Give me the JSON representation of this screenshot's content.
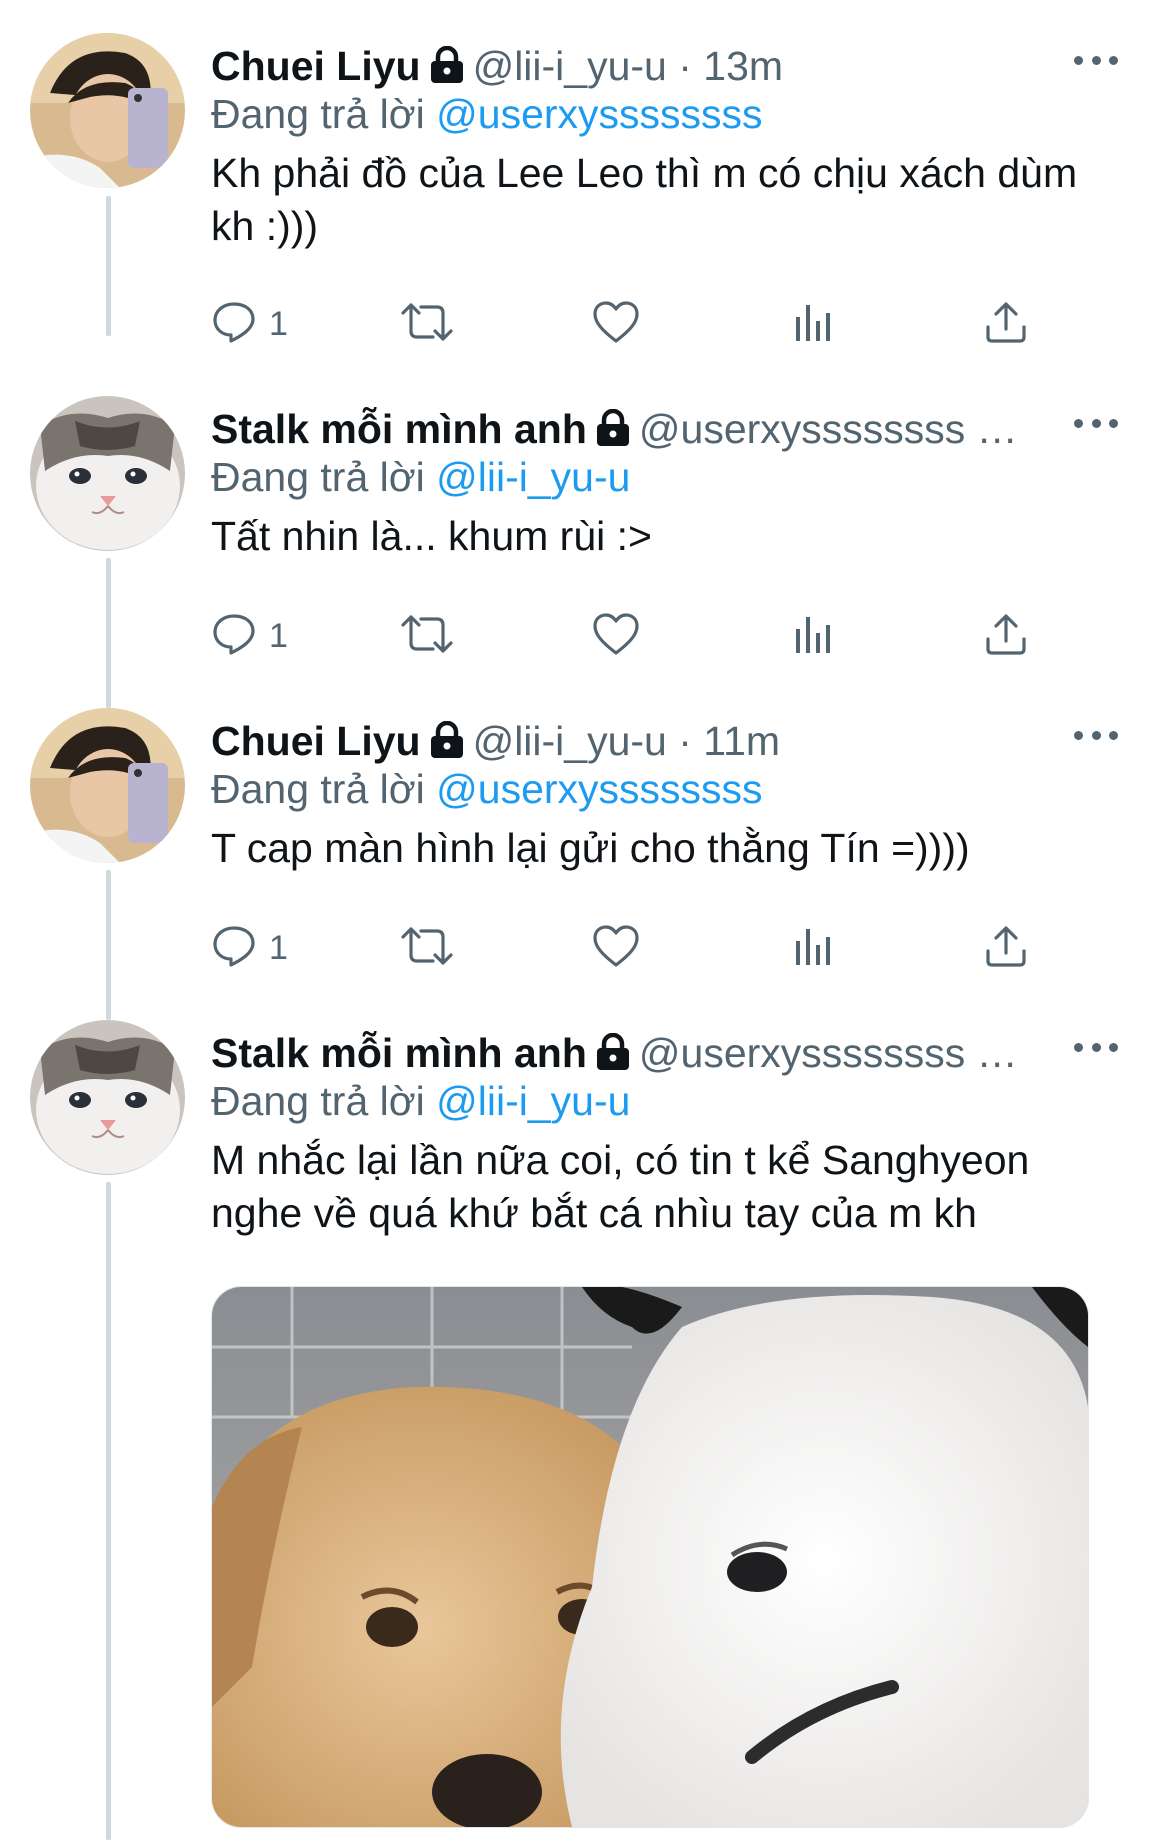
{
  "colors": {
    "accent": "#1d9bf0",
    "secondary_text": "#536471",
    "thread_line": "#cfd9de"
  },
  "tweets": [
    {
      "name": "Chuei Liyu",
      "handle": "@lii-i_yu-u",
      "time": "· 13m",
      "replying_to_label": "Đang trả lời",
      "replying_to": "@userxyssssssss",
      "text": "Kh phải đồ của Lee Leo thì m có chịu xách dùm kh :)))",
      "reply_count": "1",
      "avatar_icon": "avatar-boy-selfie-icon"
    },
    {
      "name": "Stalk mỗi mình anh",
      "handle": "@userxyssssssss …",
      "time": "",
      "replying_to_label": "Đang trả lời",
      "replying_to": "@lii-i_yu-u",
      "text": "Tất nhin là... khum rùi :>",
      "reply_count": "1",
      "avatar_icon": "avatar-cat-icon"
    },
    {
      "name": "Chuei Liyu",
      "handle": "@lii-i_yu-u",
      "time": "· 11m",
      "replying_to_label": "Đang trả lời",
      "replying_to": "@userxyssssssss",
      "text": "T cap màn hình lại gửi cho thằng Tín =))))",
      "reply_count": "1",
      "avatar_icon": "avatar-boy-selfie-icon"
    },
    {
      "name": "Stalk mỗi mình anh",
      "handle": "@userxyssssssss …",
      "time": "",
      "replying_to_label": "Đang trả lời",
      "replying_to": "@lii-i_yu-u",
      "text": "M nhắc lại lần nữa coi, có tin t kể Sanghyeon nghe về quá khứ bắt cá nhìu tay của m kh",
      "reply_count": "",
      "avatar_icon": "avatar-cat-icon",
      "media_icon": "dogs-photo"
    }
  ]
}
